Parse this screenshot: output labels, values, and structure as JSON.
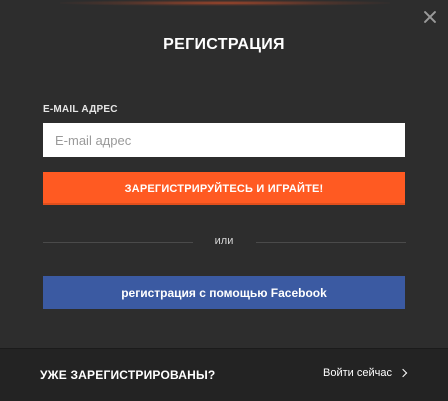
{
  "modal": {
    "title": "РЕГИСТРАЦИЯ"
  },
  "form": {
    "email_label": "E-MAIL АДРЕС",
    "email_placeholder": "E-mail адрес",
    "email_value": "",
    "register_label": "ЗАРЕГИСТРИРУЙТЕСЬ И ИГРАЙТЕ!",
    "or_text": "или",
    "facebook_label": "регистрация с помощью Facebook"
  },
  "footer": {
    "text": "УЖЕ ЗАРЕГИСТРИРОВАНЫ?",
    "login_label": "Войти сейчас"
  },
  "icons": {
    "close": "close-icon",
    "chevron": "chevron-right-icon"
  },
  "colors": {
    "background": "#2d2d2d",
    "accent": "#ff5a22",
    "facebook": "#3b5aa2",
    "footer": "#232323"
  }
}
